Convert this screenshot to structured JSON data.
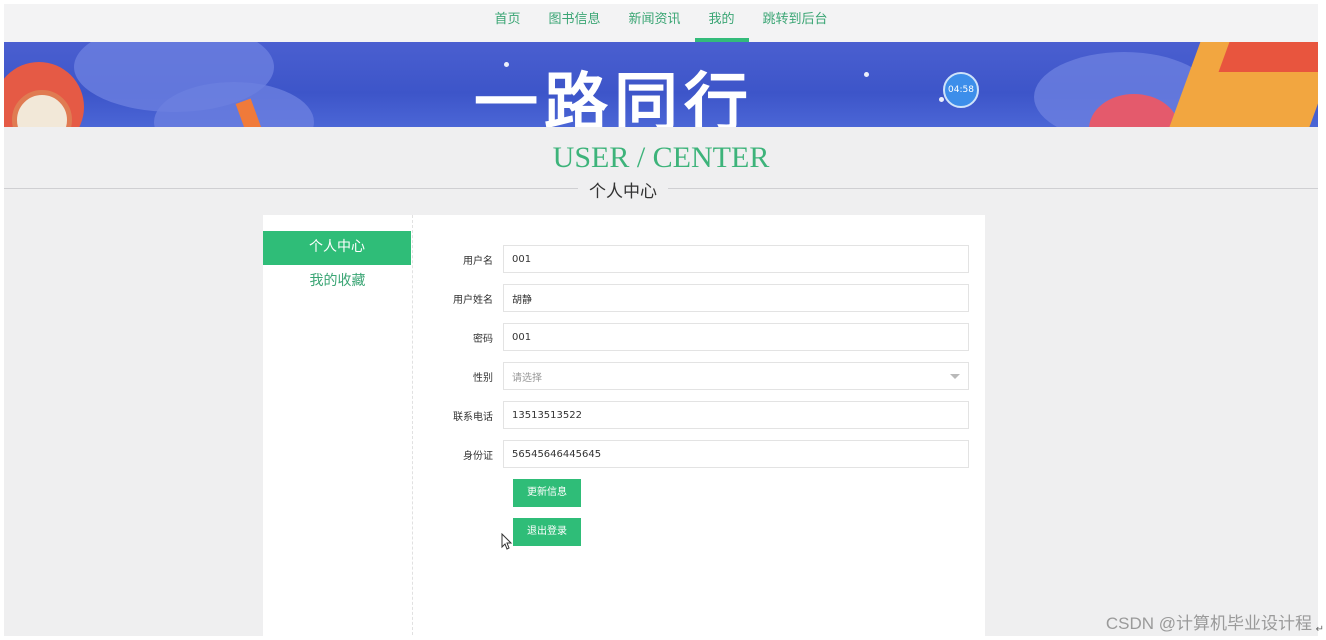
{
  "nav": {
    "items": [
      {
        "label": "首页",
        "active": false
      },
      {
        "label": "图书信息",
        "active": false
      },
      {
        "label": "新闻资讯",
        "active": false
      },
      {
        "label": "我的",
        "active": true
      },
      {
        "label": "跳转到后台",
        "active": false
      }
    ]
  },
  "banner": {
    "title": "一路同行",
    "timer": "04:58"
  },
  "header": {
    "title": "USER / CENTER",
    "subtitle": "个人中心"
  },
  "sidebar": {
    "items": [
      {
        "label": "个人中心",
        "active": true
      },
      {
        "label": "我的收藏",
        "active": false
      }
    ]
  },
  "form": {
    "username": {
      "label": "用户名",
      "value": "001"
    },
    "realname": {
      "label": "用户姓名",
      "value": "胡静"
    },
    "password": {
      "label": "密码",
      "value": "001"
    },
    "gender": {
      "label": "性别",
      "placeholder": "请选择"
    },
    "phone": {
      "label": "联系电话",
      "value": "13513513522"
    },
    "idcard": {
      "label": "身份证",
      "value": "56545646445645"
    },
    "update_label": "更新信息",
    "logout_label": "退出登录"
  },
  "watermark": "CSDN @计算机毕业设计程",
  "colors": {
    "accent": "#2fbd78",
    "link": "#3aa574",
    "banner": "#4a5fd0"
  }
}
